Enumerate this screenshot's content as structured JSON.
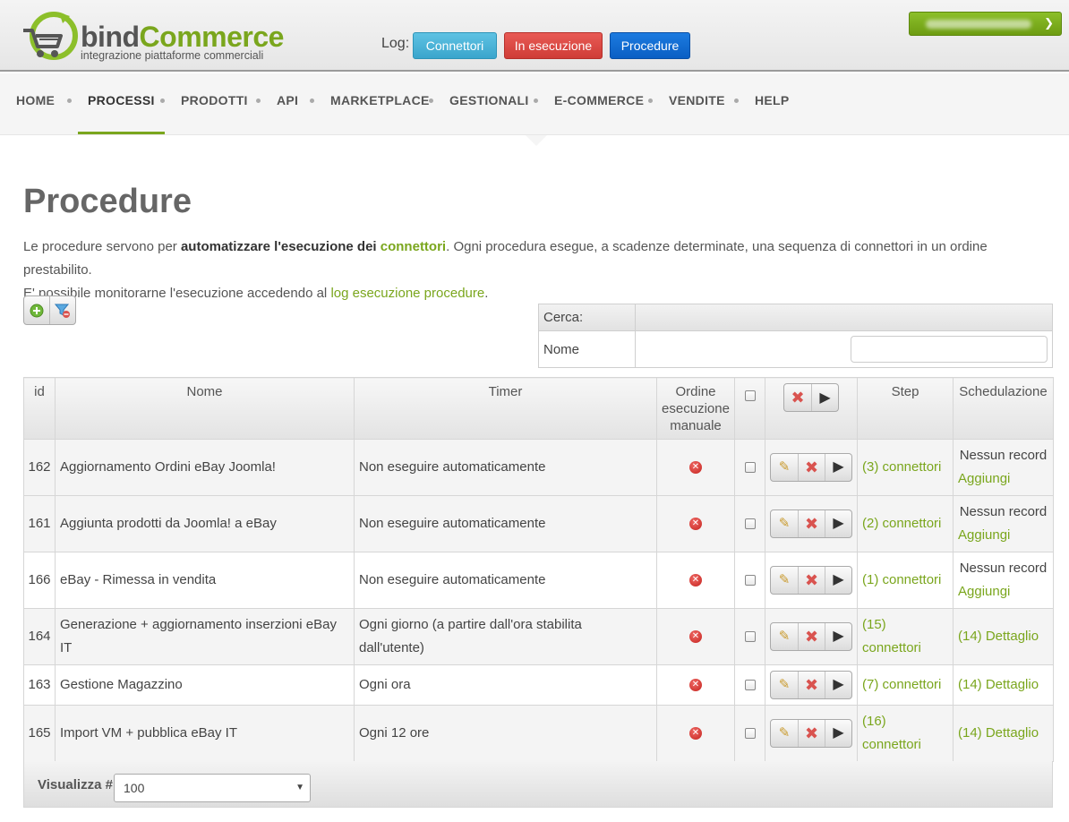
{
  "header": {
    "logo_part1": "bind",
    "logo_part2": "Commerce",
    "logo_tagline": "integrazione piattaforme commerciali",
    "log_label": "Log:",
    "buttons": [
      "Connettori",
      "In esecuzione",
      "Procedure"
    ]
  },
  "nav": {
    "items": [
      "HOME",
      "PROCESSI",
      "PRODOTTI",
      "API",
      "MARKETPLACE",
      "GESTIONALI",
      "E-COMMERCE",
      "VENDITE",
      "HELP"
    ],
    "active": "PROCESSI"
  },
  "page": {
    "title": "Procedure",
    "desc_1": "Le procedure servono per ",
    "desc_bold": "automatizzare l'esecuzione dei ",
    "desc_link_bold": "connettori",
    "desc_2": ". Ogni procedura esegue, a scadenze determinate, una sequenza di connettori in un ordine prestabilito.",
    "desc_3": "E' possibile monitorarne l'esecuzione accedendo al ",
    "desc_link": "log esecuzione procedure",
    "desc_4": "."
  },
  "search": {
    "title": "Cerca:",
    "field_label": "Nome",
    "field_value": ""
  },
  "table": {
    "headers": {
      "id": "id",
      "nome": "Nome",
      "timer": "Timer",
      "ordine": "Ordine esecuzione manuale",
      "step": "Step",
      "schedulazione": "Schedulazione"
    },
    "rows": [
      {
        "id": "162",
        "nome": "Aggiornamento Ordini eBay Joomla!",
        "timer": "Non eseguire automaticamente",
        "step": "(3) connettori",
        "sched_text": "Nessun record",
        "sched_link": "Aggiungi"
      },
      {
        "id": "161",
        "nome": "Aggiunta prodotti da Joomla! a eBay",
        "timer": "Non eseguire automaticamente",
        "step": "(2) connettori",
        "sched_text": "Nessun record",
        "sched_link": "Aggiungi"
      },
      {
        "id": "166",
        "nome": "eBay - Rimessa in vendita",
        "timer": "Non eseguire automaticamente",
        "step": "(1) connettori",
        "sched_text": "Nessun record",
        "sched_link": "Aggiungi"
      },
      {
        "id": "164",
        "nome": "Generazione + aggiornamento inserzioni eBay IT",
        "timer": "Ogni giorno (a partire dall'ora stabilita dall'utente)",
        "step": "(15) connettori",
        "sched_text": "",
        "sched_link": "(14) Dettaglio"
      },
      {
        "id": "163",
        "nome": "Gestione Magazzino",
        "timer": "Ogni ora",
        "step": "(7) connettori",
        "sched_text": "",
        "sched_link": "(14) Dettaglio"
      },
      {
        "id": "165",
        "nome": "Import VM + pubblica eBay IT",
        "timer": "Ogni 12 ore",
        "step": "(16) connettori",
        "sched_text": "",
        "sched_link": "(14) Dettaglio"
      }
    ]
  },
  "footer": {
    "label": "Visualizza #",
    "page_size": "100"
  },
  "colors": {
    "accent_green": "#7aa61d",
    "btn_connettori": "#4fb6db",
    "btn_in_esecuzione": "#dc4a44",
    "btn_procedure": "#1270d6"
  }
}
